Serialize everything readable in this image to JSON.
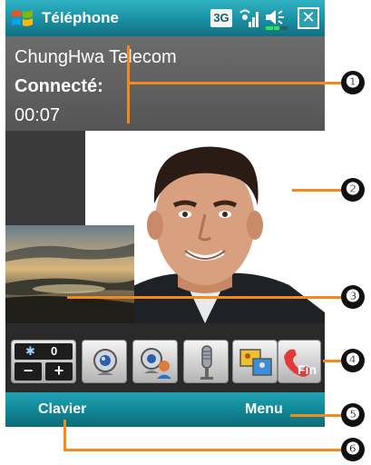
{
  "window": {
    "title": "Téléphone",
    "status_icons": [
      "windows-start-icon",
      "3g-icon",
      "signal-icon",
      "volume-icon",
      "close-icon"
    ],
    "network_badge": "3G",
    "close_label": "✕"
  },
  "call": {
    "carrier": "ChungHwa Telecom",
    "status": "Connecté:",
    "duration": "00:07"
  },
  "toolbar": {
    "brightness_value": "0",
    "brightness_minus": "−",
    "brightness_plus": "+",
    "buttons": [
      "camera-icon",
      "camera-swap-icon",
      "microphone-icon",
      "picture-in-picture-icon",
      "end-call-icon"
    ],
    "end_label": "Fin"
  },
  "softkeys": {
    "left": "Clavier",
    "right": "Menu"
  },
  "callouts": [
    "❶",
    "❷",
    "❸",
    "❹",
    "❺",
    "❻"
  ],
  "colors": {
    "title_bar": "#1a8fa3",
    "softkey_bar": "#128898",
    "callout_line": "#f28a1c",
    "end_call": "#e03a3a"
  }
}
